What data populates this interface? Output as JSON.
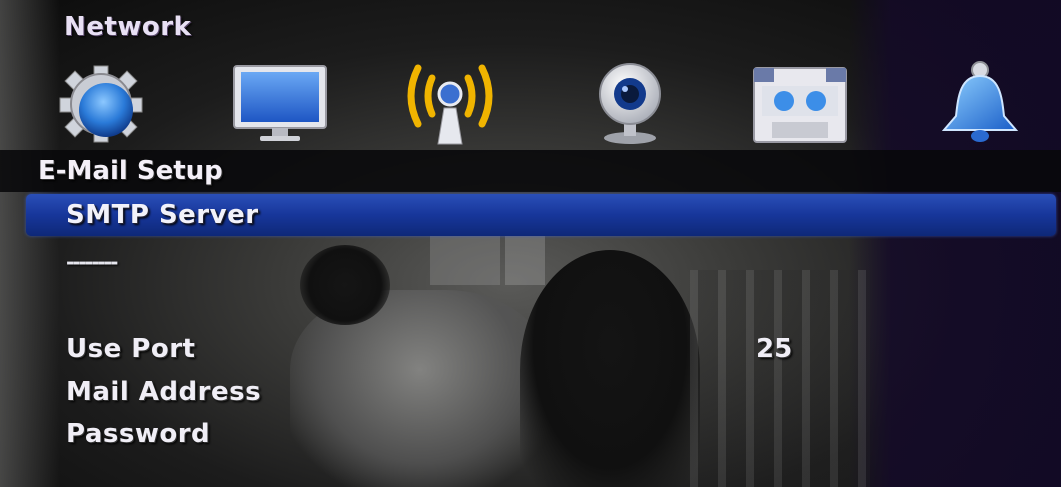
{
  "header": {
    "title": "Network"
  },
  "tabs": [
    {
      "icon": "gear-icon"
    },
    {
      "icon": "monitor-icon"
    },
    {
      "icon": "wireless-antenna-icon"
    },
    {
      "icon": "webcam-icon"
    },
    {
      "icon": "recorder-icon"
    },
    {
      "icon": "bell-icon"
    }
  ],
  "menu": {
    "section_title": "E-Mail Setup",
    "selected_item": "SMTP Server",
    "smtp_server_value": "--------",
    "settings": [
      {
        "label": "Use Port",
        "value": "25"
      },
      {
        "label": "Mail Address",
        "value": ""
      },
      {
        "label": "Password",
        "value": ""
      }
    ]
  },
  "colors": {
    "selection": "#17369a",
    "accent_antenna": "#f0b400",
    "text": "#f0eef6"
  }
}
